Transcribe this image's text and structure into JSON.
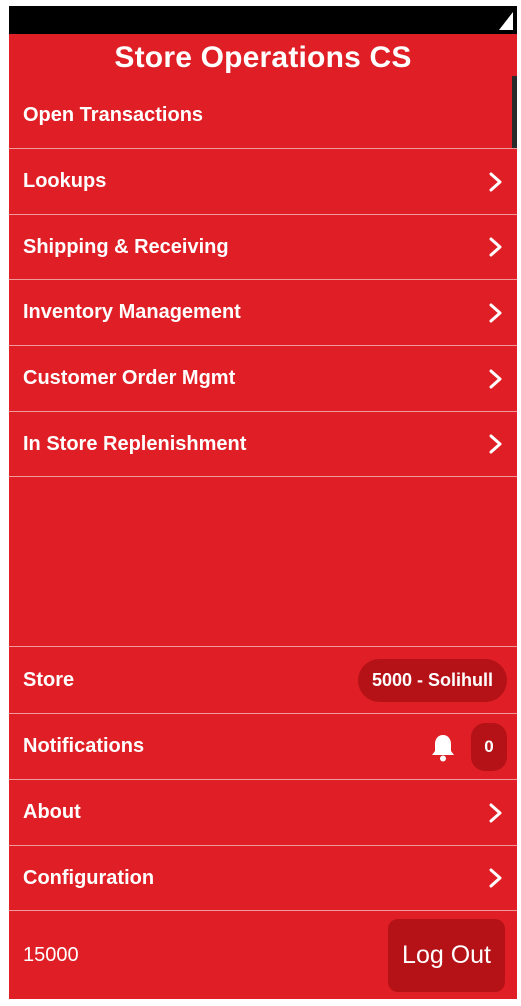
{
  "app": {
    "title": "Store Operations CS"
  },
  "menu": [
    {
      "label": "Open Transactions",
      "chevron": false,
      "icon": ""
    },
    {
      "label": "Lookups",
      "chevron": true,
      "icon": "chevron-right-icon"
    },
    {
      "label": "Shipping & Receiving",
      "chevron": true,
      "icon": "chevron-right-icon"
    },
    {
      "label": "Inventory Management",
      "chevron": true,
      "icon": "chevron-right-icon"
    },
    {
      "label": "Customer Order Mgmt",
      "chevron": true,
      "icon": "chevron-right-icon"
    },
    {
      "label": "In Store Replenishment",
      "chevron": true,
      "icon": "chevron-right-icon"
    }
  ],
  "bottom": {
    "store": {
      "label": "Store",
      "value": "5000 - Solihull"
    },
    "notifications": {
      "label": "Notifications",
      "icon": "bell-icon",
      "count": "0"
    },
    "about": {
      "label": "About",
      "icon": "chevron-right-icon"
    },
    "configuration": {
      "label": "Configuration",
      "icon": "chevron-right-icon"
    }
  },
  "footer": {
    "user_id": "15000",
    "logout_label": "Log Out"
  },
  "colors": {
    "background": "#df1f25",
    "pill": "#b51217",
    "status_bar": "#000000"
  }
}
